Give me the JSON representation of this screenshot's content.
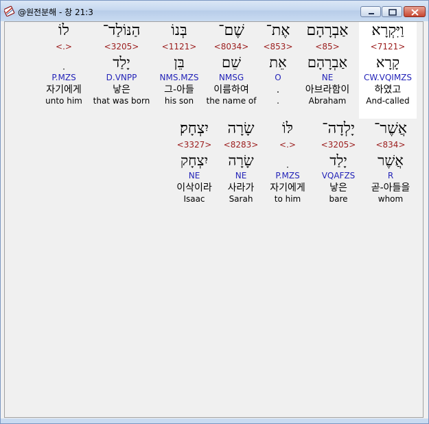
{
  "window": {
    "title": "@원전분해 - 창 21:3"
  },
  "icons": {
    "app": "bible-book-icon",
    "minimize": "minimize-icon",
    "maximize": "maximize-icon",
    "close": "close-icon"
  },
  "colors": {
    "strong_number": "#9b1c1c",
    "parsing": "#2323b8",
    "highlight": "#ffffff"
  },
  "rows": [
    {
      "words": [
        {
          "hebrew": "וַיִּקְרָא",
          "strong": "<7121>",
          "lemma": "קָרָא",
          "parse": "CW.VQIMZS",
          "korean": "하였고",
          "english": "And-called",
          "highlighted": true
        },
        {
          "hebrew": "אַבְרָהָם",
          "strong": "<85>",
          "lemma": "אַבְרָהָם",
          "parse": "NE",
          "korean": "아브라함이",
          "english": "Abraham",
          "highlighted": false
        },
        {
          "hebrew": "אֶת־",
          "strong": "<853>",
          "lemma": "אֵת",
          "parse": "O",
          "korean": ".",
          "english": ".",
          "highlighted": false
        },
        {
          "hebrew": "שֶׁם־",
          "strong": "<8034>",
          "lemma": "שֵׁם",
          "parse": "NMSG",
          "korean": "이름하여",
          "english": "the name of",
          "highlighted": false
        },
        {
          "hebrew": "בְּנוֹ",
          "strong": "<1121>",
          "lemma": "בֵּן",
          "parse": "NMS.MZS",
          "korean": "그-아들",
          "english": "his son",
          "highlighted": false
        },
        {
          "hebrew": "הַנּוֹלַד־",
          "strong": "<3205>",
          "lemma": "יָלַד",
          "parse": "D.VNPP",
          "korean": "낳은",
          "english": "that was born",
          "highlighted": false
        },
        {
          "hebrew": "לוֹ",
          "strong": "<.>",
          "lemma": "ִ",
          "parse": "P.MZS",
          "korean": "자기에게",
          "english": "unto him",
          "highlighted": false
        }
      ]
    },
    {
      "words": [
        {
          "hebrew": "אֲשֶׁר־",
          "strong": "<834>",
          "lemma": "אֲשֶׁר",
          "parse": "R",
          "korean": "곧-아들을",
          "english": "whom",
          "highlighted": false
        },
        {
          "hebrew": "יָלְדָה־",
          "strong": "<3205>",
          "lemma": "יָלַד",
          "parse": "VQAFZS",
          "korean": "낳은",
          "english": "bare",
          "highlighted": false
        },
        {
          "hebrew": "לּוֹ",
          "strong": "<.>",
          "lemma": "ִ",
          "parse": "P.MZS",
          "korean": "자기에게",
          "english": "to him",
          "highlighted": false
        },
        {
          "hebrew": "שָׂרָה",
          "strong": "<8283>",
          "lemma": "שָׂרָה",
          "parse": "NE",
          "korean": "사라가",
          "english": "Sarah",
          "highlighted": false
        },
        {
          "hebrew": "יִצְחָק׃",
          "strong": "<3327>",
          "lemma": "יִצְחָק",
          "parse": "NE",
          "korean": "이삭이라",
          "english": "Isaac",
          "highlighted": false
        }
      ]
    }
  ]
}
